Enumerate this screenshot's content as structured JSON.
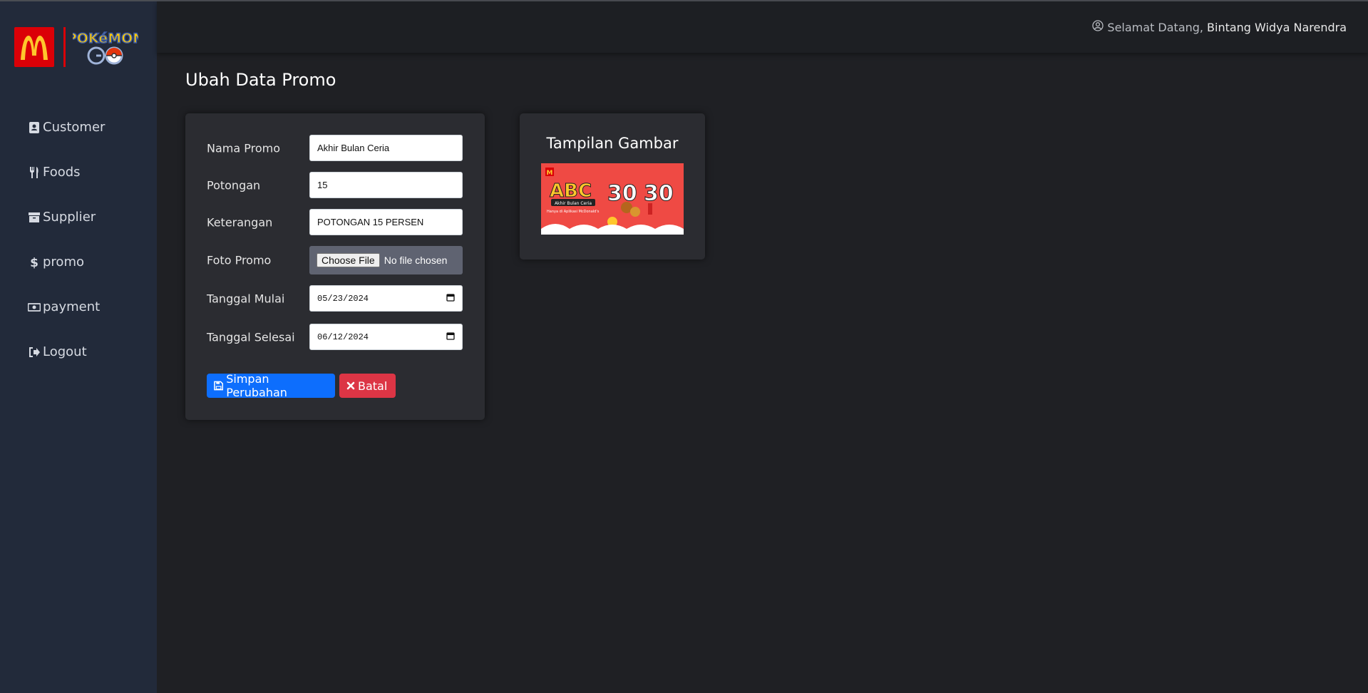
{
  "sidebar": {
    "logo_text": "M",
    "items": [
      {
        "label": "Customer",
        "icon": "address-book-icon"
      },
      {
        "label": "Foods",
        "icon": "utensils-icon"
      },
      {
        "label": "Supplier",
        "icon": "archive-box-icon"
      },
      {
        "label": "promo",
        "icon": "dollar-icon"
      },
      {
        "label": "payment",
        "icon": "money-bill-icon"
      },
      {
        "label": "Logout",
        "icon": "sign-out-icon"
      }
    ]
  },
  "header": {
    "greeting": "Selamat Datang,",
    "user_name": "Bintang Widya Narendra"
  },
  "page": {
    "title": "Ubah Data Promo"
  },
  "form": {
    "nama_promo": {
      "label": "Nama Promo",
      "value": "Akhir Bulan Ceria"
    },
    "potongan": {
      "label": "Potongan",
      "value": "15"
    },
    "keterangan": {
      "label": "Keterangan",
      "value": "POTONGAN 15 PERSEN"
    },
    "foto_promo": {
      "label": "Foto Promo",
      "button": "Choose File",
      "status": "No file chosen"
    },
    "tanggal_mulai": {
      "label": "Tanggal Mulai",
      "value": "05/23/2024"
    },
    "tanggal_selesai": {
      "label": "Tanggal Selesai",
      "value": "06/12/2024"
    },
    "save_label": "Simpan Perubahan",
    "cancel_label": "Batal"
  },
  "preview": {
    "title": "Tampilan Gambar",
    "image_text": {
      "brand": "ABC",
      "subtitle": "Akhir Bulan Ceria",
      "value_left": "30",
      "value_right": "30",
      "caption": "Hanya di Aplikasi McDonald's"
    }
  },
  "colors": {
    "sidebar": "#222a3a",
    "primary": "#0d6efd",
    "danger": "#dc3545",
    "mcd_red": "#db0007",
    "mcd_yellow": "#ffc72c"
  }
}
